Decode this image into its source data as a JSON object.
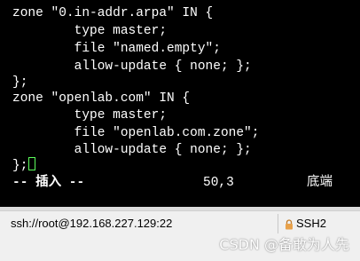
{
  "editor": {
    "lines": [
      "zone \"0.in-addr.arpa\" IN {",
      "        type master;",
      "        file \"named.empty\";",
      "        allow-update { none; };",
      "};",
      "zone \"openlab.com\" IN {",
      "        type master;",
      "        file \"openlab.com.zone\";",
      "        allow-update { none; };",
      "};"
    ],
    "status": {
      "mode": "-- 插入 --",
      "position": "50,3",
      "scroll": "底端"
    }
  },
  "statusbar": {
    "connection": "ssh://root@192.168.227.129:22",
    "protocol": "SSH2",
    "lock_icon": "lock-icon"
  },
  "watermark": {
    "text": "CSDN @备敢为人先"
  },
  "colors": {
    "terminal_bg": "#000000",
    "terminal_fg": "#ffffff",
    "cursor": "#5cff5c",
    "statusbar_bg": "#f0f0f0",
    "lock": "#e8a14a"
  }
}
